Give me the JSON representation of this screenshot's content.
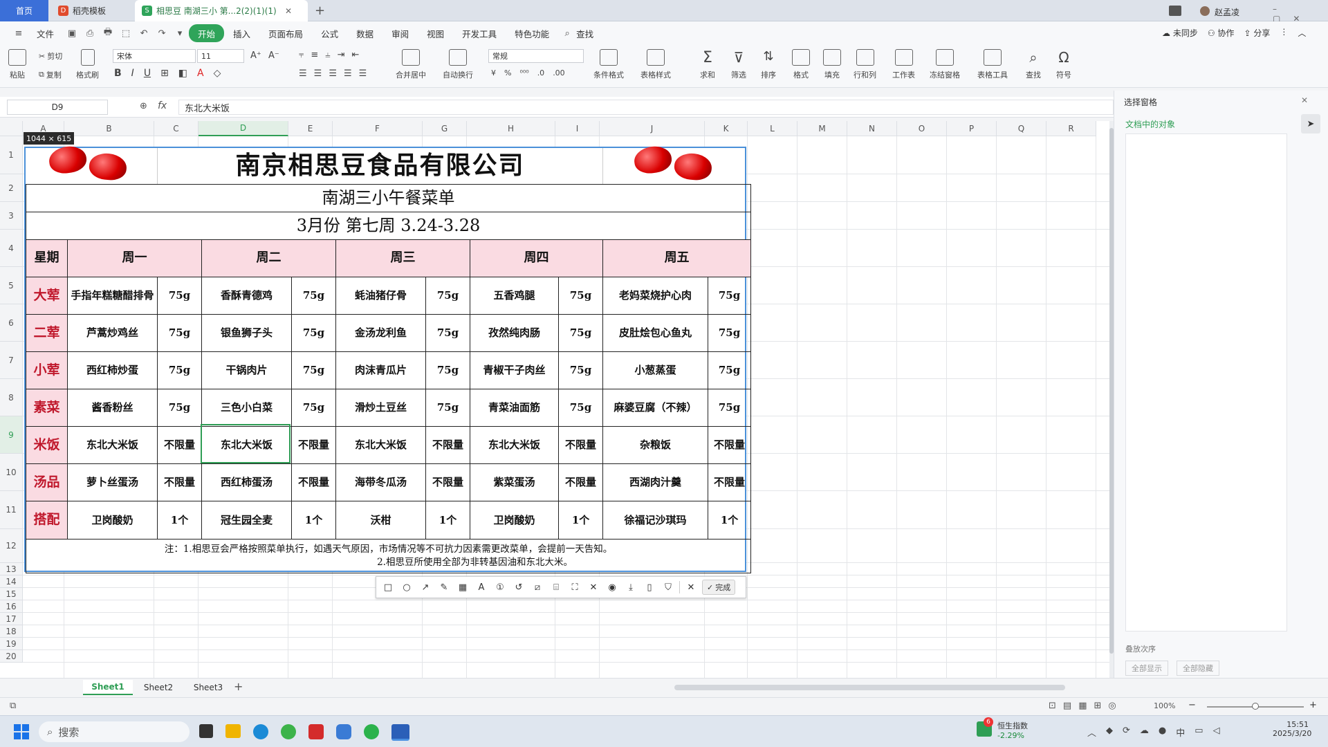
{
  "tabs": {
    "home": "首页",
    "t2": "稻壳模板",
    "t3": "相思豆 南湖三小 第...2(2)(1)(1)"
  },
  "user": {
    "name": "赵孟凌"
  },
  "menu": [
    "文件",
    "开始",
    "插入",
    "页面布局",
    "公式",
    "数据",
    "审阅",
    "视图",
    "开发工具",
    "特色功能",
    "查找"
  ],
  "menu_right": {
    "sync": "未同步",
    "collab": "协作",
    "share": "分享"
  },
  "ribbon": {
    "paste": "粘贴",
    "cut": "剪切",
    "copy": "复制",
    "format_painter": "格式刷",
    "font_name": "宋体",
    "font_size": "11",
    "number_format": "常规",
    "merge": "合并居中",
    "wrap": "自动换行",
    "cond_format": "条件格式",
    "table_style": "表格样式",
    "sum": "求和",
    "filter": "筛选",
    "sort": "排序",
    "format": "格式",
    "fill": "填充",
    "rowcol": "行和列",
    "worksheet": "工作表",
    "freeze": "冻结窗格",
    "table_tools": "表格工具",
    "find": "查找",
    "symbol": "符号"
  },
  "formula": {
    "cell_ref": "D9",
    "fx": "fx",
    "value": "东北大米饭"
  },
  "columns": [
    "A",
    "B",
    "C",
    "D",
    "E",
    "F",
    "G",
    "H",
    "I",
    "J",
    "K",
    "L",
    "M",
    "N",
    "O",
    "P",
    "Q",
    "R"
  ],
  "rows": [
    "1",
    "2",
    "3",
    "4",
    "5",
    "6",
    "7",
    "8",
    "9",
    "10",
    "11",
    "12",
    "13",
    "14",
    "15",
    "16",
    "17",
    "18",
    "19",
    "20"
  ],
  "snip": {
    "size": "1044 × 615",
    "done": "完成"
  },
  "menu_sheet": {
    "title": "南京相思豆食品有限公司",
    "subtitle": "南湖三小午餐菜单",
    "period": "3月份  第七周  3.24-3.28",
    "header": {
      "week": "星期",
      "days": [
        "周一",
        "周二",
        "周三",
        "周四",
        "周五"
      ]
    },
    "rows": [
      {
        "meal": "大荤",
        "items": [
          [
            "手指年糕糖醋排骨",
            "75g"
          ],
          [
            "香酥青德鸡",
            "75g"
          ],
          [
            "蚝油猪仔骨",
            "75g"
          ],
          [
            "五香鸡腿",
            "75g"
          ],
          [
            "老妈菜烧护心肉",
            "75g"
          ]
        ]
      },
      {
        "meal": "二荤",
        "items": [
          [
            "芦蒿炒鸡丝",
            "75g"
          ],
          [
            "银鱼狮子头",
            "75g"
          ],
          [
            "金汤龙利鱼",
            "75g"
          ],
          [
            "孜然纯肉肠",
            "75g"
          ],
          [
            "皮肚烩包心鱼丸",
            "75g"
          ]
        ]
      },
      {
        "meal": "小荤",
        "items": [
          [
            "西红柿炒蛋",
            "75g"
          ],
          [
            "干锅肉片",
            "75g"
          ],
          [
            "肉沫青瓜片",
            "75g"
          ],
          [
            "青椒干子肉丝",
            "75g"
          ],
          [
            "小葱蒸蛋",
            "75g"
          ]
        ]
      },
      {
        "meal": "素菜",
        "items": [
          [
            "酱香粉丝",
            "75g"
          ],
          [
            "三色小白菜",
            "75g"
          ],
          [
            "滑炒土豆丝",
            "75g"
          ],
          [
            "青菜油面筋",
            "75g"
          ],
          [
            "麻婆豆腐（不辣）",
            "75g"
          ]
        ]
      },
      {
        "meal": "米饭",
        "items": [
          [
            "东北大米饭",
            "不限量"
          ],
          [
            "东北大米饭",
            "不限量"
          ],
          [
            "东北大米饭",
            "不限量"
          ],
          [
            "东北大米饭",
            "不限量"
          ],
          [
            "杂粮饭",
            "不限量"
          ]
        ]
      },
      {
        "meal": "汤品",
        "items": [
          [
            "萝卜丝蛋汤",
            "不限量"
          ],
          [
            "西红柿蛋汤",
            "不限量"
          ],
          [
            "海带冬瓜汤",
            "不限量"
          ],
          [
            "紫菜蛋汤",
            "不限量"
          ],
          [
            "西湖肉汁羹",
            "不限量"
          ]
        ]
      },
      {
        "meal": "搭配",
        "items": [
          [
            "卫岗酸奶",
            "1个"
          ],
          [
            "冠生园全麦",
            "1个"
          ],
          [
            "沃柑",
            "1个"
          ],
          [
            "卫岗酸奶",
            "1个"
          ],
          [
            "徐福记沙琪玛",
            "1个"
          ]
        ]
      }
    ],
    "note1": "注：1.相思豆会严格按照菜单执行，如遇天气原因，市场情况等不可抗力因素需更改菜单，会提前一天告知。",
    "note2": "2.相思豆所使用全部为非转基因油和东北大米。"
  },
  "pane": {
    "title": "选择窗格",
    "objects": "文档中的对象",
    "order": "叠放次序",
    "show_all": "全部显示",
    "hide_all": "全部隐藏"
  },
  "sheets": [
    "Sheet1",
    "Sheet2",
    "Sheet3"
  ],
  "status": {
    "zoom": "100%"
  },
  "taskbar": {
    "search": "搜索",
    "stock_name": "恒生指数",
    "stock_change": "-2.29%",
    "stock_badge": "6",
    "ime": "中",
    "time": "15:51",
    "date": "2025/3/20"
  }
}
